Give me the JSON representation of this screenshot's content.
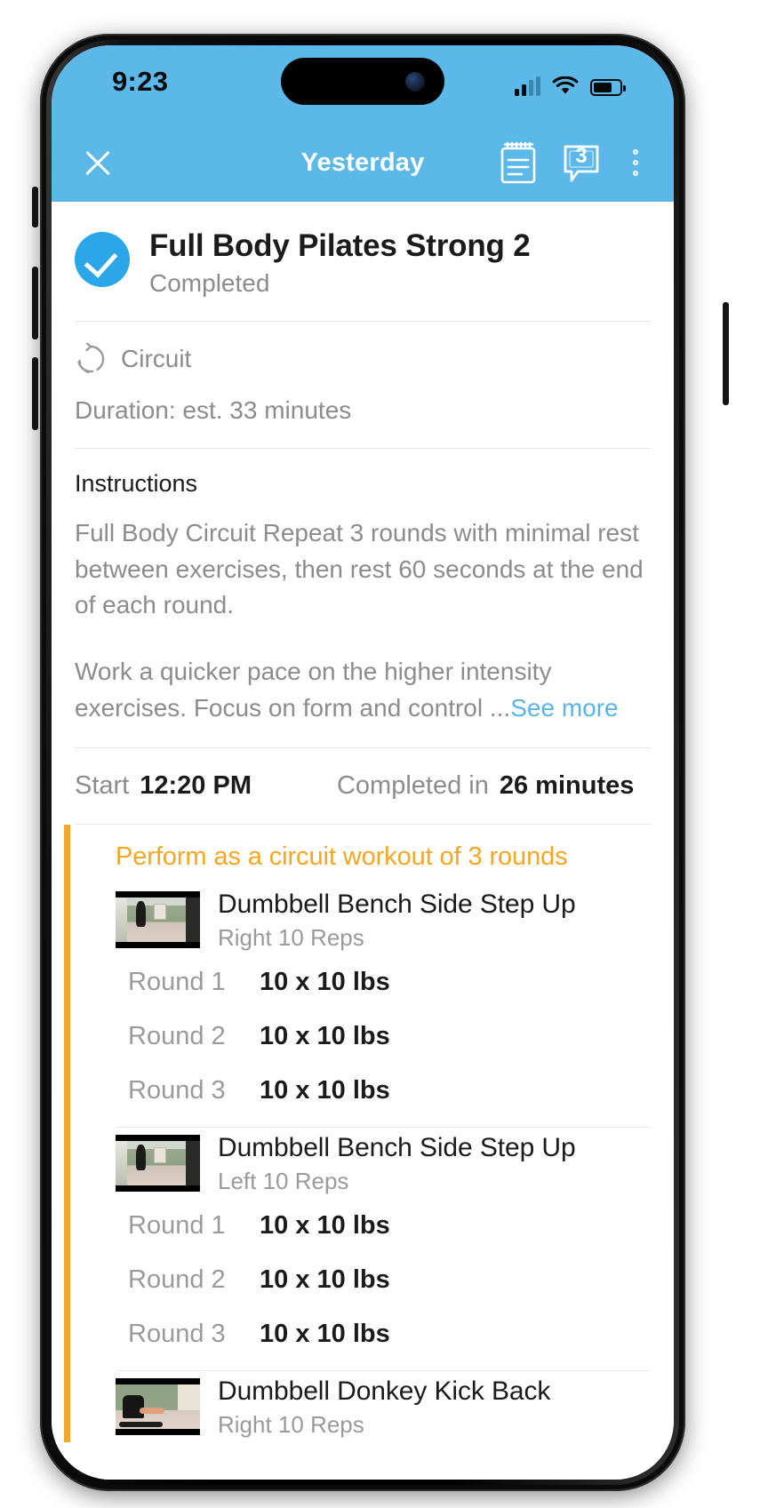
{
  "status_bar": {
    "time": "9:23",
    "icons": [
      "cellular-signal-icon",
      "wifi-icon",
      "battery-icon"
    ]
  },
  "nav": {
    "close_icon": "close-icon",
    "title": "Yesterday",
    "notes_icon": "notepad-icon",
    "comments_icon": "chat-bubble-icon",
    "comments_count": "3",
    "overflow_icon": "kebab-menu-icon"
  },
  "workout": {
    "title": "Full Body Pilates Strong 2",
    "status": "Completed",
    "status_icon": "check-circle-icon",
    "type_icon": "circuit-repeat-icon",
    "type_label": "Circuit",
    "duration": "Duration: est. 33 minutes"
  },
  "instructions": {
    "heading": "Instructions",
    "paragraph_1": "Full Body Circuit Repeat 3 rounds with minimal rest between exercises, then rest 60 seconds at the end of each round.",
    "paragraph_2": "Work a quicker pace on the higher intensity exercises. Focus on form and control ...",
    "see_more_label": "See more"
  },
  "times": {
    "start_label": "Start",
    "start_value": "12:20 PM",
    "completed_label": "Completed in",
    "completed_value": "26 minutes"
  },
  "circuit": {
    "heading": "Perform as a circuit workout of 3 rounds",
    "accent_color": "#f5a623",
    "exercises": [
      {
        "name": "Dumbbell Bench Side Step Up",
        "detail": "Right 10 Reps",
        "thumbnail": "gym-hallway-step-up-thumbnail",
        "rounds": [
          {
            "label": "Round 1",
            "value": "10 x 10 lbs"
          },
          {
            "label": "Round 2",
            "value": "10 x 10 lbs"
          },
          {
            "label": "Round 3",
            "value": "10 x 10 lbs"
          }
        ]
      },
      {
        "name": "Dumbbell Bench Side Step Up",
        "detail": "Left 10 Reps",
        "thumbnail": "gym-hallway-step-up-thumbnail",
        "rounds": [
          {
            "label": "Round 1",
            "value": "10 x 10 lbs"
          },
          {
            "label": "Round 2",
            "value": "10 x 10 lbs"
          },
          {
            "label": "Round 3",
            "value": "10 x 10 lbs"
          }
        ]
      },
      {
        "name": "Dumbbell Donkey Kick Back",
        "detail": "Right 10 Reps",
        "thumbnail": "donkey-kick-back-thumbnail",
        "rounds": []
      }
    ]
  },
  "colors": {
    "header_blue": "#5bb8e8",
    "accent_blue": "#2ba6e8",
    "link_blue": "#59b4ec",
    "circuit_orange": "#f5a623"
  }
}
